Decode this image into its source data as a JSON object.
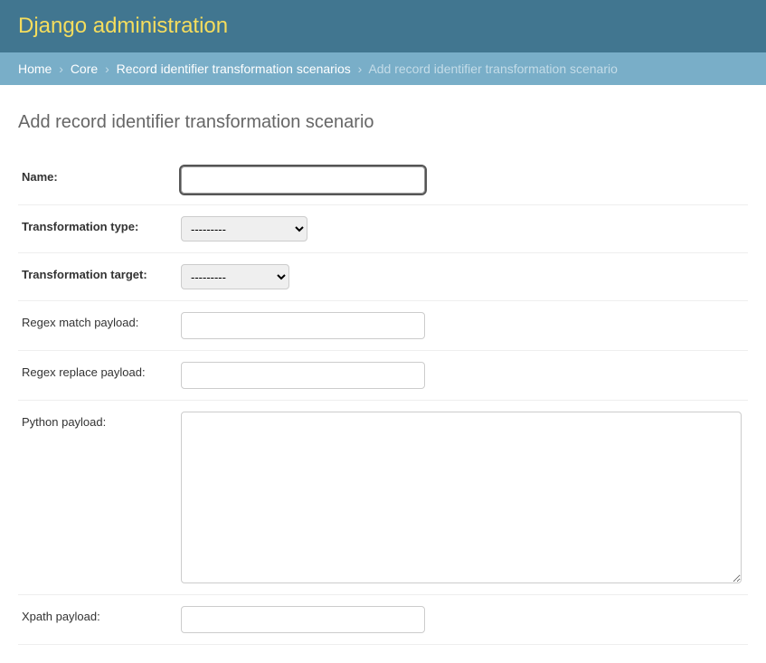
{
  "header": {
    "site_title": "Django administration"
  },
  "breadcrumbs": {
    "home": "Home",
    "app": "Core",
    "model": "Record identifier transformation scenarios",
    "current": "Add record identifier transformation scenario"
  },
  "page": {
    "title": "Add record identifier transformation scenario"
  },
  "form": {
    "name": {
      "label": "Name:",
      "value": ""
    },
    "transformation_type": {
      "label": "Transformation type:",
      "selected": "---------"
    },
    "transformation_target": {
      "label": "Transformation target:",
      "selected": "---------"
    },
    "regex_match_payload": {
      "label": "Regex match payload:",
      "value": ""
    },
    "regex_replace_payload": {
      "label": "Regex replace payload:",
      "value": ""
    },
    "python_payload": {
      "label": "Python payload:",
      "value": ""
    },
    "xpath_payload": {
      "label": "Xpath payload:",
      "value": ""
    }
  }
}
